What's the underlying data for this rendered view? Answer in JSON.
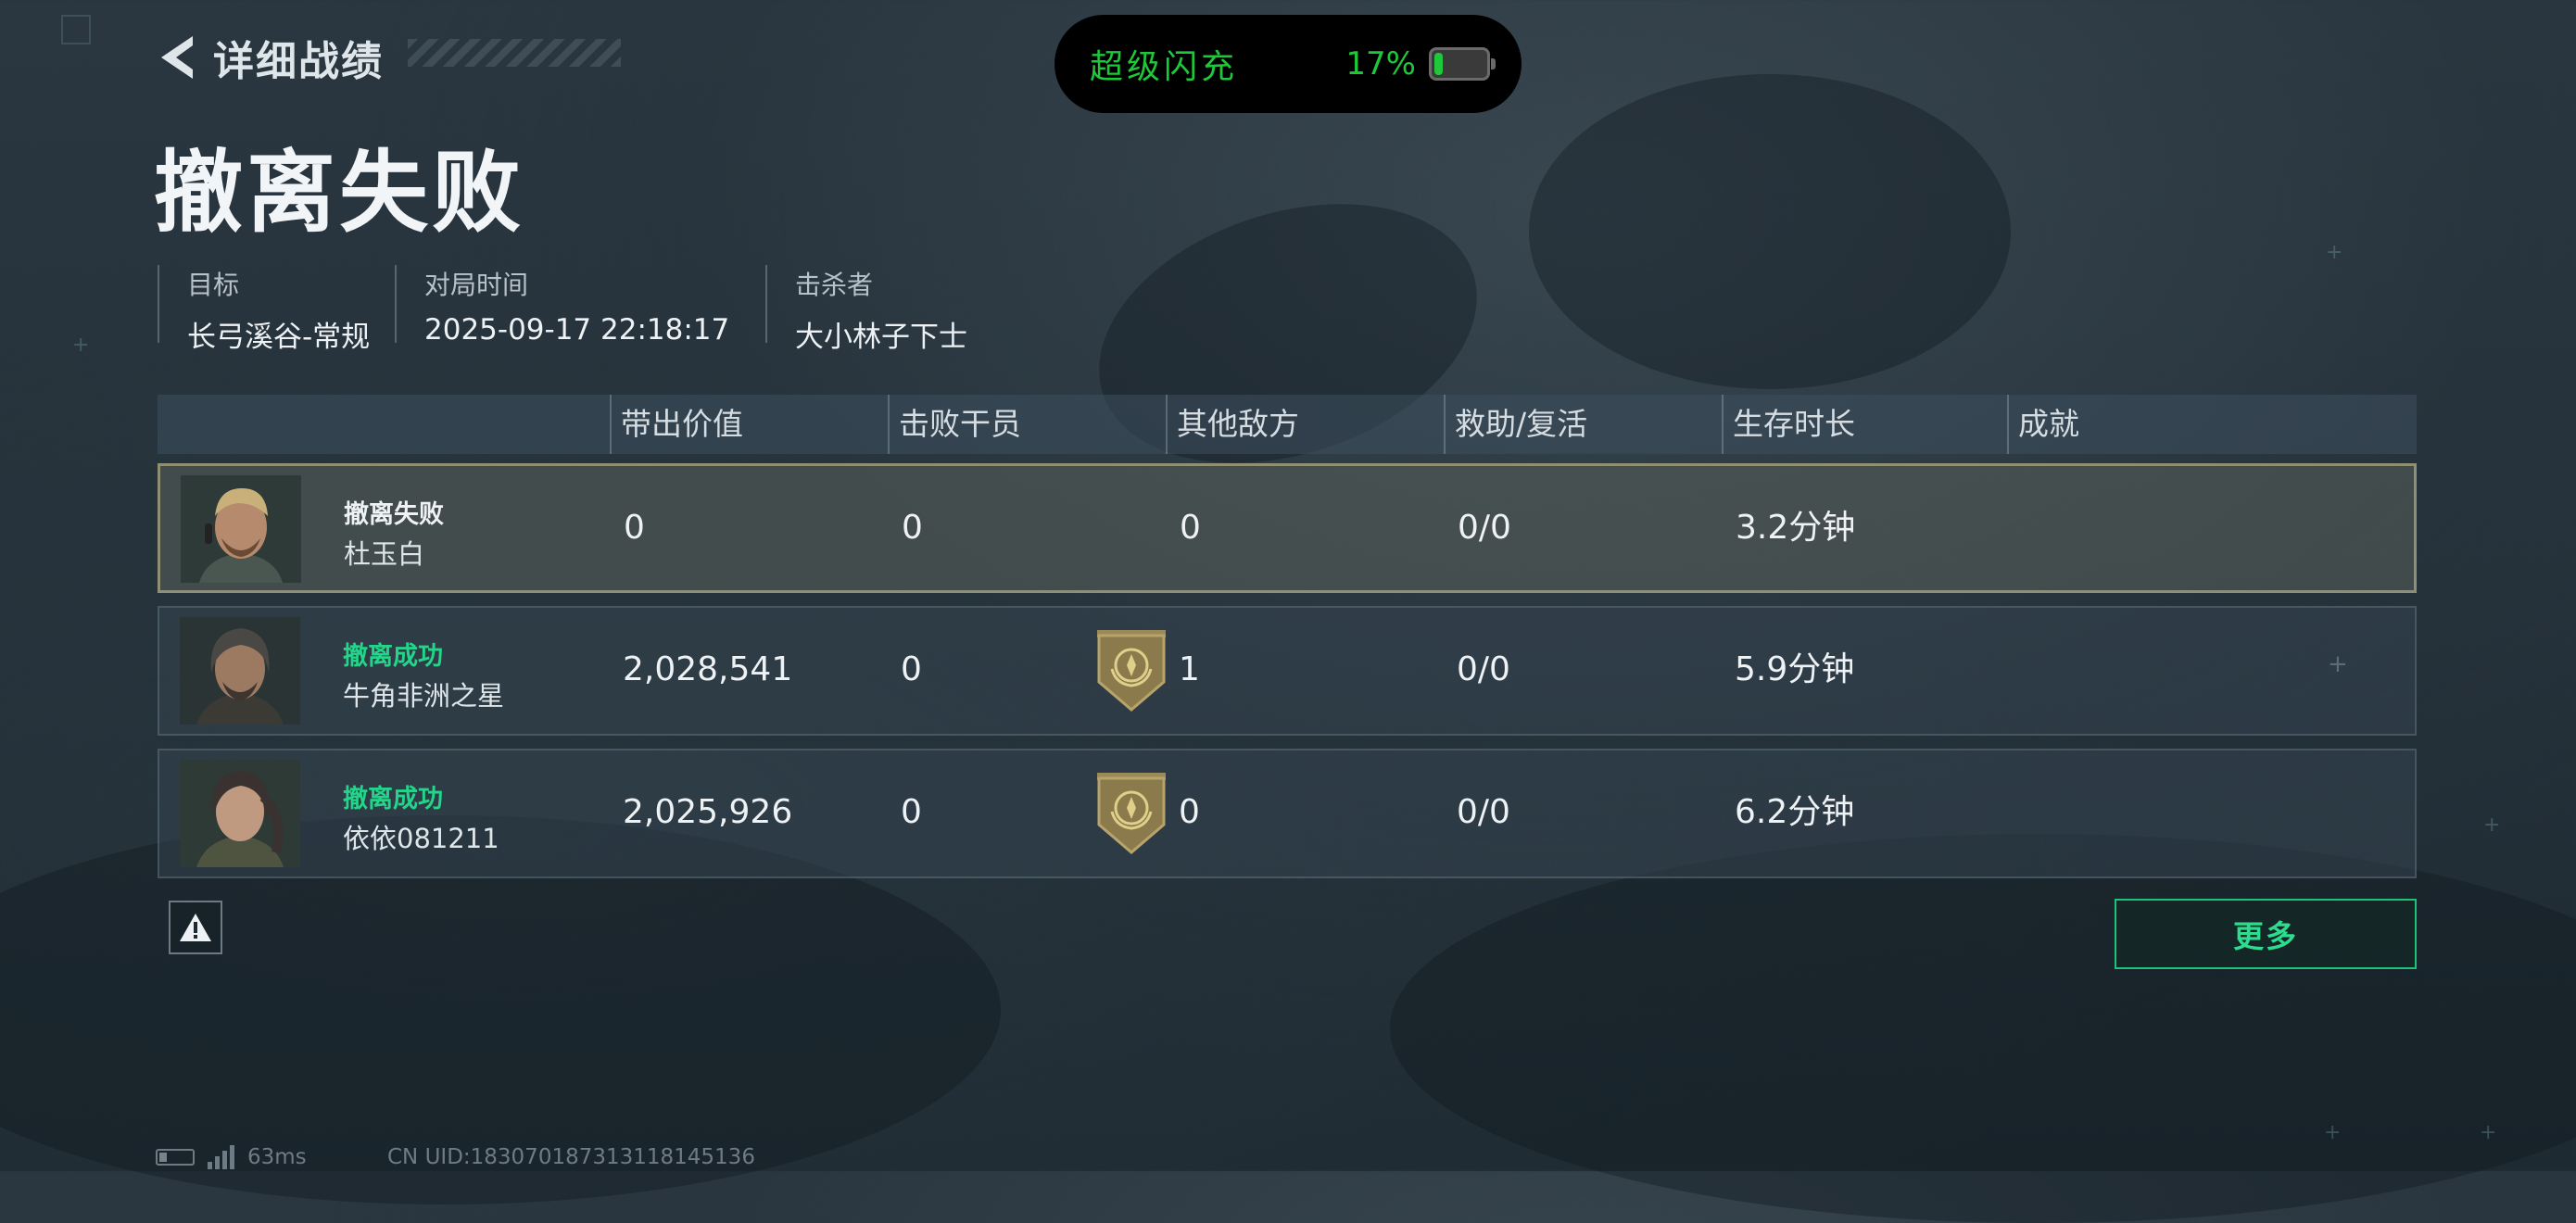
{
  "header": {
    "back_label": "详细战绩",
    "back_icon": "chevron-left-icon"
  },
  "status_pill": {
    "label": "超级闪充",
    "battery_text": "17%",
    "battery_level": 0.17,
    "color": "#1ec83a"
  },
  "result_title": "撤离失败",
  "meta": [
    {
      "label": "目标",
      "value": "长弓溪谷-常规"
    },
    {
      "label": "对局时间",
      "value": "2025-09-17 22:18:17"
    },
    {
      "label": "击杀者",
      "value": "大小林子下士"
    }
  ],
  "table": {
    "columns": [
      "带出价值",
      "击败干员",
      "其他敌方",
      "救助/复活",
      "生存时长",
      "成就"
    ],
    "rows": [
      {
        "status": "撤离失败",
        "name": "杜玉白",
        "value": "0",
        "kills": "0",
        "other": "0",
        "assist": "0/0",
        "survival": "3.2分钟",
        "medal": false,
        "highlight": true
      },
      {
        "status": "撤离成功",
        "name": "牛角非洲之星",
        "value": "2,028,541",
        "kills": "0",
        "other": "1",
        "assist": "0/0",
        "survival": "5.9分钟",
        "medal": true,
        "highlight": false
      },
      {
        "status": "撤离成功",
        "name": "依依081211",
        "value": "2,025,926",
        "kills": "0",
        "other": "0",
        "assist": "0/0",
        "survival": "6.2分钟",
        "medal": true,
        "highlight": false
      }
    ]
  },
  "buttons": {
    "report_icon": "warning-icon",
    "more": "更多"
  },
  "footer": {
    "ping": "63ms",
    "uid": "CN UID:183070187313118145136"
  },
  "colors": {
    "success": "#24d48a",
    "accent": "#1fc27a",
    "highlight_border": "#aaa582"
  }
}
